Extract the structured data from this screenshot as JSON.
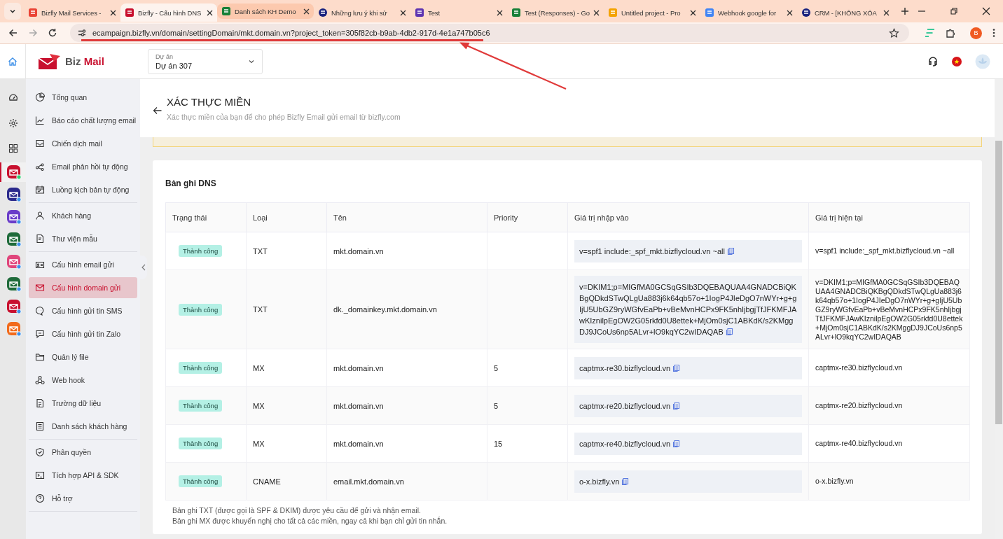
{
  "browser": {
    "tabs": [
      {
        "title": "Bizfly Mail Services -",
        "selected": false
      },
      {
        "title": "Bizfly - Cấu hình DNS",
        "selected": true
      },
      {
        "title": "Danh sách KH Demo",
        "selected": false
      },
      {
        "title": "Những lưu ý khi sử",
        "selected": false
      },
      {
        "title": "Test",
        "selected": false
      },
      {
        "title": "Test (Responses) - Go",
        "selected": false
      },
      {
        "title": "Untitled project - Pro",
        "selected": false
      },
      {
        "title": "Webhook google for",
        "selected": false
      },
      {
        "title": "CRM - [KHÔNG XÓA",
        "selected": false
      }
    ],
    "url": "ecampaign.bizfly.vn/domain/settingDomain/mkt.domain.vn?project_token=305f82cb-b9ab-4db2-917d-4e1a747b05c6",
    "profile_initial": "B"
  },
  "header": {
    "logo": {
      "prefix": "Biz",
      "suffix": "Mail"
    },
    "project": {
      "label": "Dự án",
      "value": "Dự án 307"
    }
  },
  "apps": [
    {
      "selected": true
    },
    {
      "selected": false
    },
    {
      "selected": false
    },
    {
      "selected": false
    },
    {
      "selected": false
    },
    {
      "selected": false
    },
    {
      "selected": false
    },
    {
      "selected": false
    }
  ],
  "sidebar": {
    "groups": [
      [
        {
          "label": "Tổng quan",
          "selected": false
        },
        {
          "label": "Báo cáo chất lượng email",
          "selected": false
        },
        {
          "label": "Chiến dịch mail",
          "selected": false
        },
        {
          "label": "Email phản hồi tự động",
          "selected": false
        },
        {
          "label": "Luồng kịch bản tự động",
          "selected": false
        }
      ],
      [
        {
          "label": "Khách hàng",
          "selected": false
        },
        {
          "label": "Thư viện mẫu",
          "selected": false
        }
      ],
      [
        {
          "label": "Cấu hình email gửi",
          "selected": false
        },
        {
          "label": "Cấu hình domain gửi",
          "selected": true
        },
        {
          "label": "Cấu hình gửi tin SMS",
          "selected": false
        },
        {
          "label": "Cấu hình gửi tin Zalo",
          "selected": false
        },
        {
          "label": "Quản lý file",
          "selected": false
        },
        {
          "label": "Web hook",
          "selected": false
        },
        {
          "label": "Trường dữ liệu",
          "selected": false
        },
        {
          "label": "Danh sách khách hàng",
          "selected": false
        }
      ],
      [
        {
          "label": "Phân quyền",
          "selected": false
        },
        {
          "label": "Tích hợp API & SDK",
          "selected": false
        },
        {
          "label": "Hỗ trợ",
          "selected": false
        }
      ]
    ]
  },
  "page": {
    "title": "XÁC THỰC MIỀN",
    "subtitle": "Xác thực miền của bạn để cho phép Bizfly Email gửi email từ bizfly.com"
  },
  "dns": {
    "title": "Bản ghi DNS",
    "columns": [
      "Trạng thái",
      "Loại",
      "Tên",
      "Priority",
      "Giá trị nhập vào",
      "Giá trị hiện tại"
    ],
    "rows": [
      {
        "status": "Thành công",
        "type": "TXT",
        "name": "mkt.domain.vn",
        "priority": "",
        "input_value": "v=spf1 include:_spf_mkt.bizflycloud.vn ~all",
        "current_value": "v=spf1 include:_spf_mkt.bizflycloud.vn ~all"
      },
      {
        "status": "Thành công",
        "type": "TXT",
        "name": "dk._domainkey.mkt.domain.vn",
        "priority": "",
        "input_value": "v=DKIM1;p=MIGfMA0GCSqGSIb3DQEBAQUAA4GNADCBiQKBgQDkdSTwQLgUa883j6k64qb57o+1IogP4JIeDgO7nWYr+g+gIjU5UbGZ9ryWGfvEaPb+vBeMvnHCPx9FK5nhIjbgjTfJFKMFJAwKIznilpEgOW2G05rkfd0U8ettek+MjOm0sjC1ABKdK/s2KMggDJ9JCoUs6np5ALvr+lO9kqYC2wIDAQAB",
        "current_value": "v=DKIM1;p=MIGfMA0GCSqGSIb3DQEBAQUAA4GNADCBiQKBgQDkdSTwQLgUa883j6k64qb57o+1IogP4JIeDgO7nWYr+g+gIjU5UbGZ9ryWGfvEaPb+vBeMvnHCPx9FK5nhIjbgjTfJFKMFJAwKIznilpEgOW2G05rkfd0U8ettek+MjOm0sjC1ABKdK/s2KMggDJ9JCoUs6np5ALvr+lO9kqYC2wIDAQAB"
      },
      {
        "status": "Thành công",
        "type": "MX",
        "name": "mkt.domain.vn",
        "priority": "5",
        "input_value": "captmx-re30.bizflycloud.vn",
        "current_value": "captmx-re30.bizflycloud.vn"
      },
      {
        "status": "Thành công",
        "type": "MX",
        "name": "mkt.domain.vn",
        "priority": "5",
        "input_value": "captmx-re20.bizflycloud.vn",
        "current_value": "captmx-re20.bizflycloud.vn"
      },
      {
        "status": "Thành công",
        "type": "MX",
        "name": "mkt.domain.vn",
        "priority": "15",
        "input_value": "captmx-re40.bizflycloud.vn",
        "current_value": "captmx-re40.bizflycloud.vn"
      },
      {
        "status": "Thành công",
        "type": "CNAME",
        "name": "email.mkt.domain.vn",
        "priority": "",
        "input_value": "o-x.bizfly.vn",
        "current_value": "o-x.bizfly.vn"
      }
    ],
    "notes": [
      "Bản ghi TXT (được gọi là SPF & DKIM) được yêu cầu để gửi và nhận email.",
      "Bản ghi MX được khuyến nghị cho tất cả các miền, ngay cả khi bạn chỉ gửi tin nhắn."
    ]
  }
}
